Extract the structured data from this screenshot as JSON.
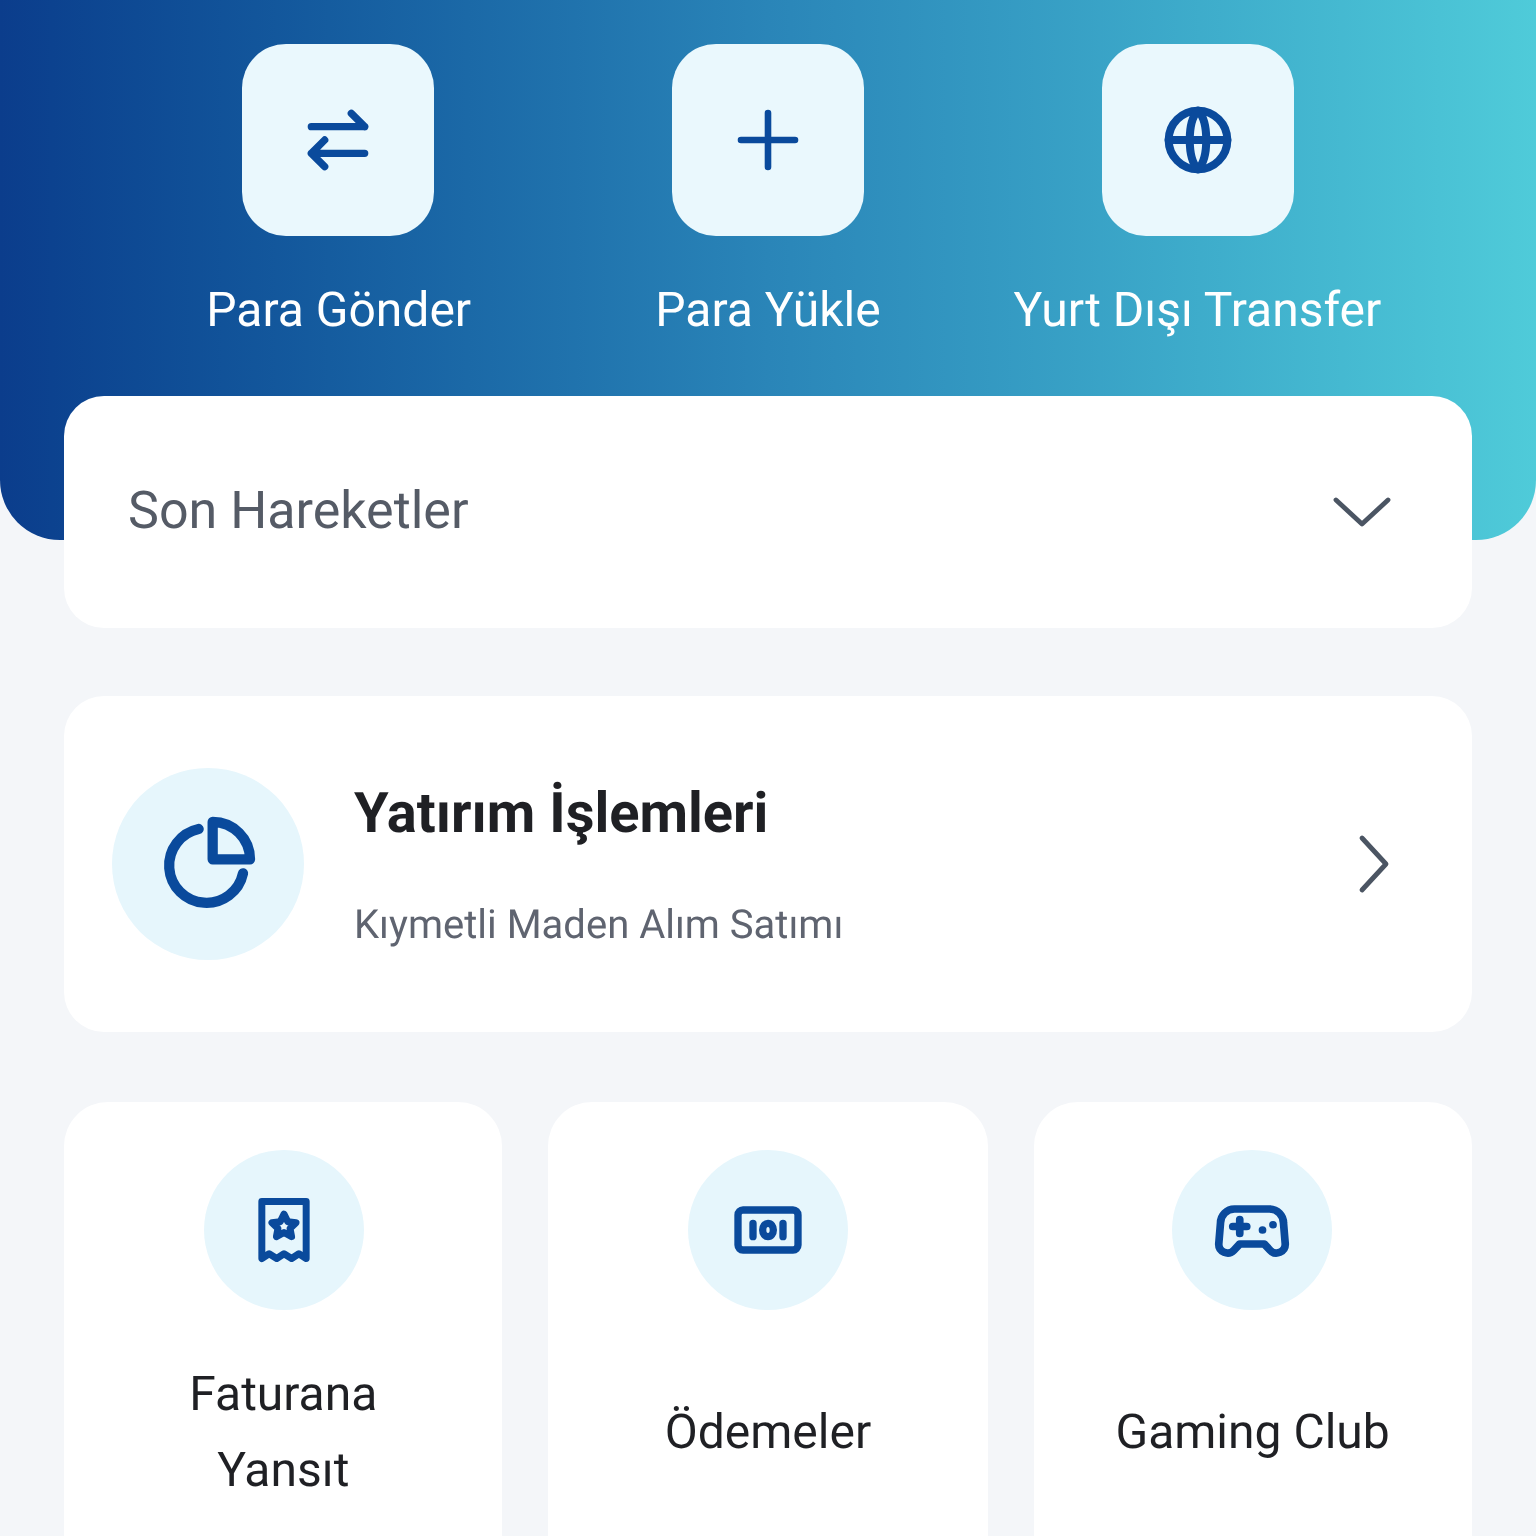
{
  "quick_actions": [
    {
      "label": "Para Gönder"
    },
    {
      "label": "Para Yükle"
    },
    {
      "label": "Yurt Dışı Transfer"
    }
  ],
  "recent": {
    "title": "Son Hareketler",
    "expanded": false
  },
  "investment": {
    "title": "Yatırım İşlemleri",
    "subtitle": "Kıymetli Maden Alım Satımı"
  },
  "tiles": [
    {
      "label": "Faturana Yansıt"
    },
    {
      "label": "Ödemeler"
    },
    {
      "label": "Gaming Club"
    }
  ]
}
